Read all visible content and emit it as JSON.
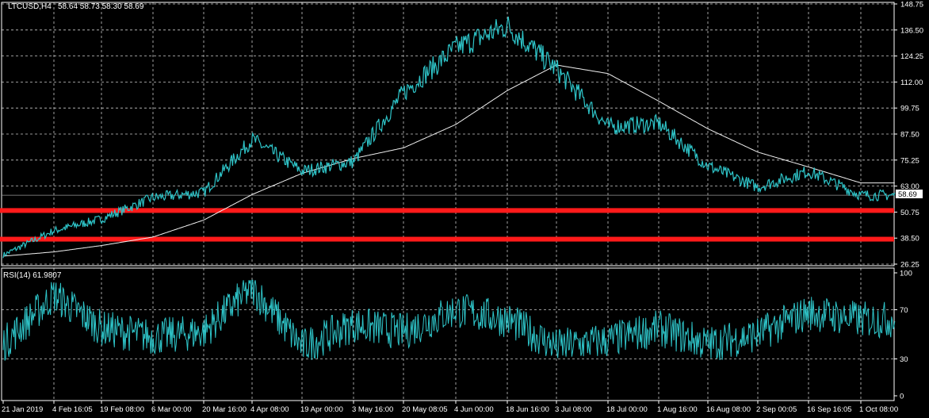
{
  "header": {
    "symbol": "LTCUSD,H4",
    "ohlc": "58.64 58.73 58.30 58.69"
  },
  "colors": {
    "background": "#000000",
    "grid": "#c8c8c8",
    "frame": "#ffffff",
    "candles": "#2ec4c8",
    "ma": "#f0f0f0",
    "levels": "#ff1a1a",
    "text": "#ffffff",
    "last_price_box": "#ffffff"
  },
  "chart_data": [
    {
      "type": "line",
      "title": "LTCUSD,H4",
      "series": [
        {
          "name": "LTCUSD,H4",
          "x": [
            "21 Jan 2019",
            "4 Feb 16:05",
            "19 Feb 08:00",
            "6 Mar 00:00",
            "20 Mar 16:00",
            "4 Apr 08:00",
            "19 Apr 00:00",
            "3 May 16:00",
            "20 May 08:05",
            "4 Jun 00:00",
            "18 Jun 16:00",
            "3 Jul 08:00",
            "18 Jul 00:00",
            "1 Aug 16:00",
            "16 Aug 08:00",
            "2 Sep 00:05",
            "16 Sep 16:05",
            "1 Oct 08:00"
          ],
          "values": [
            30.5,
            42.0,
            47.5,
            57.5,
            60.0,
            85.0,
            70.0,
            74.5,
            107.0,
            128.0,
            138.5,
            118.0,
            91.0,
            92.5,
            72.5,
            62.5,
            70.0,
            58.7
          ]
        },
        {
          "name": "MA",
          "x": [
            "21 Jan 2019",
            "4 Feb 16:05",
            "19 Feb 08:00",
            "6 Mar 00:00",
            "20 Mar 16:00",
            "4 Apr 08:00",
            "19 Apr 00:00",
            "3 May 16:00",
            "20 May 08:05",
            "4 Jun 00:00",
            "18 Jun 16:00",
            "3 Jul 08:00",
            "18 Jul 00:00",
            "1 Aug 16:00",
            "16 Aug 08:00",
            "2 Sep 00:05",
            "16 Sep 16:05",
            "1 Oct 08:00"
          ],
          "values": [
            30.0,
            32.0,
            35.0,
            39.0,
            47.0,
            59.0,
            69.0,
            76.0,
            81.0,
            92.0,
            108.0,
            120.0,
            116.0,
            103.0,
            90.0,
            79.0,
            72.0,
            64.5
          ]
        }
      ],
      "horizontal_levels": [
        51.5,
        38.0
      ],
      "last_price": "58.69",
      "y_ticks": [
        "148.75",
        "136.50",
        "124.25",
        "112.00",
        "99.75",
        "87.50",
        "75.25",
        "63.00",
        "50.75",
        "38.50",
        "26.25"
      ],
      "ylim": [
        26.25,
        148.75
      ],
      "x_ticks": [
        "21 Jan 2019",
        "4 Feb 16:05",
        "19 Feb 08:00",
        "6 Mar 00:00",
        "20 Mar 16:00",
        "4 Apr 08:00",
        "19 Apr 00:00",
        "3 May 16:00",
        "20 May 08:05",
        "4 Jun 00:00",
        "18 Jun 16:00",
        "3 Jul 08:00",
        "18 Jul 00:00",
        "1 Aug 16:00",
        "16 Aug 08:00",
        "2 Sep 00:05",
        "16 Sep 16:05",
        "1 Oct 08:00"
      ],
      "grid": true
    },
    {
      "type": "line",
      "title": "RSI(14) 61.9807",
      "series": [
        {
          "name": "RSI(14)",
          "x": [
            "21 Jan 2019",
            "4 Feb 16:05",
            "19 Feb 08:00",
            "6 Mar 00:00",
            "20 Mar 16:00",
            "4 Apr 08:00",
            "19 Apr 00:00",
            "3 May 16:00",
            "20 May 08:05",
            "4 Jun 00:00",
            "18 Jun 16:00",
            "3 Jul 08:00",
            "18 Jul 00:00",
            "1 Aug 16:00",
            "16 Aug 08:00",
            "2 Sep 00:05",
            "16 Sep 16:05",
            "1 Oct 08:00"
          ],
          "values": [
            42,
            82,
            55,
            48,
            52,
            88,
            40,
            58,
            52,
            70,
            62,
            40,
            45,
            55,
            42,
            50,
            68,
            61.98
          ]
        }
      ],
      "y_ticks": [
        "100",
        "70",
        "30",
        "0"
      ],
      "ylim": [
        0,
        100
      ],
      "grid": true
    }
  ]
}
